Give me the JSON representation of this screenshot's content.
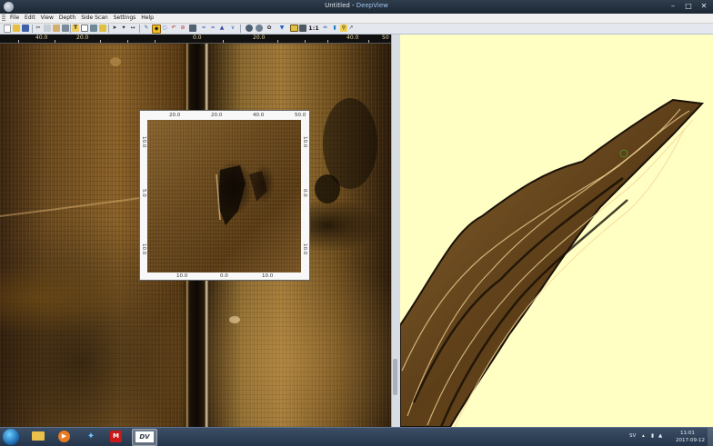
{
  "window": {
    "app_icon": "deepview-icon",
    "title_doc": "Untitled - ",
    "title_app": "DeepView",
    "controls": [
      "minimize-icon",
      "maximize-icon",
      "close-icon"
    ]
  },
  "menu": [
    "File",
    "Edit",
    "View",
    "Depth",
    "Side Scan",
    "Settings",
    "Help"
  ],
  "toolbar": {
    "scale_label": "1:1"
  },
  "sonar": {
    "ruler_ticks": [
      "40.0",
      "20.0",
      "0.0",
      "20.0",
      "40.0",
      "50"
    ]
  },
  "magnifier": {
    "top_ticks": [
      "20.0",
      "20.0",
      "40.0",
      "50.0"
    ],
    "bottom_ticks": [
      "10.0",
      "0.0",
      "10.0"
    ],
    "left_ticks": [
      "10.0",
      "5.0",
      "10.0"
    ],
    "right_ticks": [
      "10.0",
      "0.0",
      "10.0"
    ]
  },
  "taskbar": {
    "tasks": [
      "windows-explorer-icon",
      "media-player-icon",
      "network-tool-icon",
      "security-icon",
      "deepview-icon"
    ],
    "language": "SV",
    "time": "11:01",
    "date": "2017-09-12"
  },
  "colors": {
    "map_background": "#ffffc4",
    "sonar_brown": "#8a6128",
    "taskbar": "#24344a"
  }
}
